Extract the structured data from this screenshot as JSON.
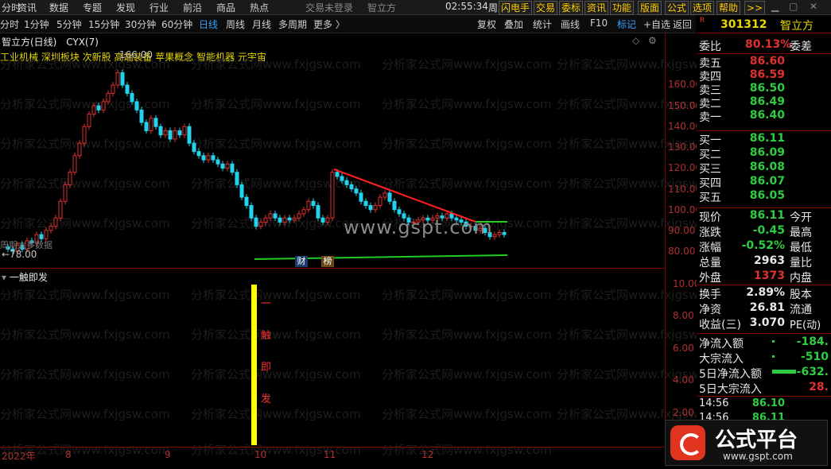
{
  "menu": {
    "left": [
      "分时",
      "资讯",
      "数据",
      "专题",
      "发现",
      "行业",
      "前沿",
      "商品",
      "热点"
    ],
    "login": "交易未登录",
    "brand": "智立方",
    "time": "02:55:34",
    "weekday": "周五",
    "right": [
      "闪电手",
      "交易",
      "委标",
      "资讯",
      "功能",
      "版面",
      "公式",
      "选项",
      "帮助"
    ],
    "more": ">>"
  },
  "toolbar": {
    "periods": [
      "分时",
      "1分钟",
      "5分钟",
      "15分钟",
      "30分钟",
      "60分钟",
      "日线",
      "周线",
      "月线",
      "多周期",
      "更多 〉"
    ],
    "active": "日线",
    "right": [
      "复权",
      "叠加",
      "统计",
      "画线",
      "F10",
      "+自选",
      "返回"
    ]
  },
  "chart": {
    "title": "智立方(日线)",
    "indicator": "CYX(7)",
    "concepts": "工业机械 深圳板块 次新股 高端装备 苹果概念 智能机器 元宇宙",
    "high_label": "166.00",
    "low_label": "←78.00",
    "note": "周期太多数据",
    "events": [
      "财",
      "榜"
    ],
    "y_labels": [
      "160.00",
      "150.00",
      "140.00",
      "130.00",
      "120.00",
      "110.00",
      "100.00",
      "90.00",
      "80.00"
    ],
    "watermark": "分析家公式网www.fxjgsw.com",
    "site": "www.gspt.com"
  },
  "subchart": {
    "title": "一触即发",
    "bar_text": [
      "一",
      "触",
      "即",
      "发"
    ],
    "y_labels": [
      "10.00",
      "8.00",
      "6.00",
      "4.00",
      "2.00"
    ],
    "x_labels": [
      "2022年",
      "8",
      "9",
      "10",
      "11",
      "12"
    ]
  },
  "quote": {
    "code": "301312",
    "name": "智立方",
    "flag": "R",
    "webi": {
      "label": "委比",
      "value": "80.13%",
      "label2": "委差"
    },
    "asks": [
      {
        "label": "卖五",
        "price": "86.60"
      },
      {
        "label": "卖四",
        "price": "86.59"
      },
      {
        "label": "卖三",
        "price": "86.50"
      },
      {
        "label": "卖二",
        "price": "86.49"
      },
      {
        "label": "卖一",
        "price": "86.40"
      }
    ],
    "bids": [
      {
        "label": "买一",
        "price": "86.11"
      },
      {
        "label": "买二",
        "price": "86.09"
      },
      {
        "label": "买三",
        "price": "86.08"
      },
      {
        "label": "买四",
        "price": "86.07"
      },
      {
        "label": "买五",
        "price": "86.05"
      }
    ],
    "stats": [
      {
        "label": "现价",
        "value": "86.11",
        "label2": "今开",
        "color": "#2ecc40"
      },
      {
        "label": "涨跌",
        "value": "-0.45",
        "label2": "最高",
        "color": "#2ecc40"
      },
      {
        "label": "涨幅",
        "value": "-0.52%",
        "label2": "最低",
        "color": "#2ecc40"
      },
      {
        "label": "总量",
        "value": "2963",
        "label2": "量比",
        "color": "#e8e8e8"
      },
      {
        "label": "外盘",
        "value": "1373",
        "label2": "内盘",
        "color": "#e03030"
      }
    ],
    "stats2": [
      {
        "label": "换手",
        "value": "2.89%",
        "label2": "股本",
        "color": "#e8e8e8"
      },
      {
        "label": "净资",
        "value": "26.81",
        "label2": "流通",
        "color": "#e8e8e8"
      },
      {
        "label": "收益(三)",
        "value": "3.070",
        "label2": "PE(动)",
        "color": "#e8e8e8"
      }
    ],
    "flows": [
      {
        "label": "净流入额",
        "value": "-184.",
        "color": "#2ecc40"
      },
      {
        "label": "大宗流入",
        "value": "-510",
        "color": "#2ecc40"
      },
      {
        "label": "5日净流入额",
        "value": "-632.",
        "color": "#2ecc40"
      },
      {
        "label": "5日大宗流入",
        "value": "28.",
        "color": "#e03030"
      }
    ],
    "ticks": [
      {
        "time": "14:56",
        "price": "86.10"
      },
      {
        "time": "14:56",
        "price": "86.11"
      }
    ]
  },
  "logo": {
    "name": "公式平台",
    "url": "www.gspt.com"
  },
  "colors": {
    "up": "#e03030",
    "down": "#22d3ee",
    "price_up": "#e03030",
    "price_down": "#2ecc40",
    "accent": "#ffff00"
  }
}
